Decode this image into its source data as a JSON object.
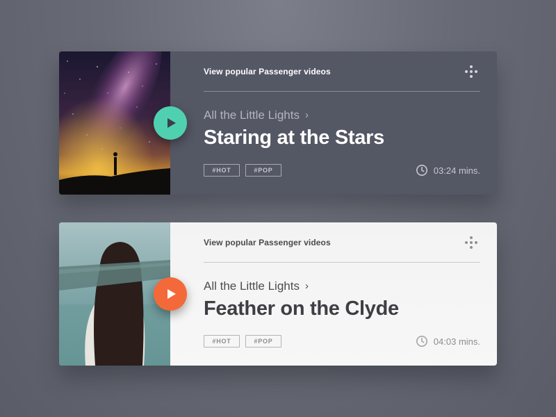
{
  "colors": {
    "background": "#6b6e78",
    "dark_card": "#545764",
    "light_card": "#f5f5f5",
    "play_teal": "#4fd1b0",
    "play_orange": "#f4693a"
  },
  "cards": [
    {
      "theme": "dark",
      "header": "View popular Passenger videos",
      "menu_icon": "dots-grid-icon",
      "album": "All the Little Lights",
      "title": "Staring at the Stars",
      "tags": [
        "#HOT",
        "#POP"
      ],
      "duration": "03:24 mins.",
      "thumbnail": "milky-way-silhouette",
      "play_icon": "play-icon"
    },
    {
      "theme": "light",
      "header": "View popular Passenger videos",
      "menu_icon": "dots-grid-icon",
      "album": "All the Little Lights",
      "title": "Feather on the Clyde",
      "tags": [
        "#HOT",
        "#POP"
      ],
      "duration": "04:03 mins.",
      "thumbnail": "blindfolded-woman",
      "play_icon": "play-icon"
    }
  ]
}
